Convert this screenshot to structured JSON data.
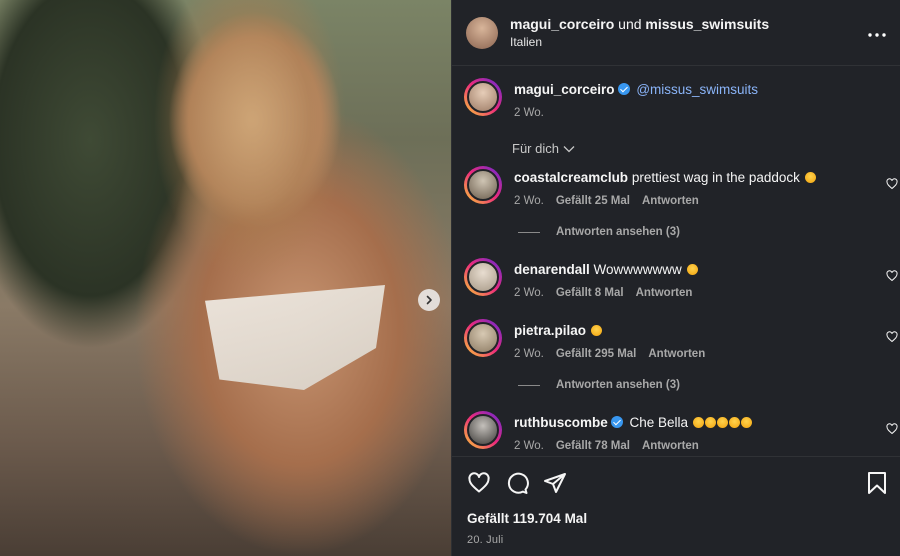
{
  "post": {
    "image_alt": "Foto",
    "header": {
      "author": "magui_corceiro",
      "conjunction": "und",
      "collaborator": "missus_swimsuits",
      "location": "Italien"
    },
    "caption": {
      "author": "magui_corceiro",
      "mention": "@missus_swimsuits",
      "time": "2 Wo."
    },
    "sort_label": "Für dich",
    "comments": [
      {
        "user": "coastalcreamclub",
        "verified": false,
        "text": "prettiest wag in the paddock",
        "emoji_count": 1,
        "time": "2 Wo.",
        "likes": "Gefällt 25 Mal",
        "reply": "Antworten",
        "view_replies": "Antworten ansehen (3)"
      },
      {
        "user": "denarendall",
        "verified": false,
        "text": "Wowwwwwww",
        "emoji_count": 1,
        "time": "2 Wo.",
        "likes": "Gefällt 8 Mal",
        "reply": "Antworten",
        "view_replies": ""
      },
      {
        "user": "pietra.pilao",
        "verified": false,
        "text": "",
        "emoji_count": 1,
        "time": "2 Wo.",
        "likes": "Gefällt 295 Mal",
        "reply": "Antworten",
        "view_replies": "Antworten ansehen (3)"
      },
      {
        "user": "ruthbuscombe",
        "verified": true,
        "text": "Che Bella",
        "emoji_count": 5,
        "time": "2 Wo.",
        "likes": "Gefällt 78 Mal",
        "reply": "Antworten",
        "view_replies": ""
      }
    ],
    "likes_total": "Gefällt 119.704 Mal",
    "date": "20. Juli"
  },
  "icons": {
    "more": "more-horizontal-icon",
    "like": "heart-icon",
    "comment": "comment-bubble-icon",
    "share": "paper-plane-icon",
    "save": "bookmark-icon",
    "next": "chevron-right-icon",
    "verified": "verified-badge-icon"
  },
  "colors": {
    "panel_bg": "#212328",
    "text": "#f5f5f5",
    "muted": "#a8a8a8",
    "mention": "#8ab4f8",
    "verified": "#3897f0"
  }
}
